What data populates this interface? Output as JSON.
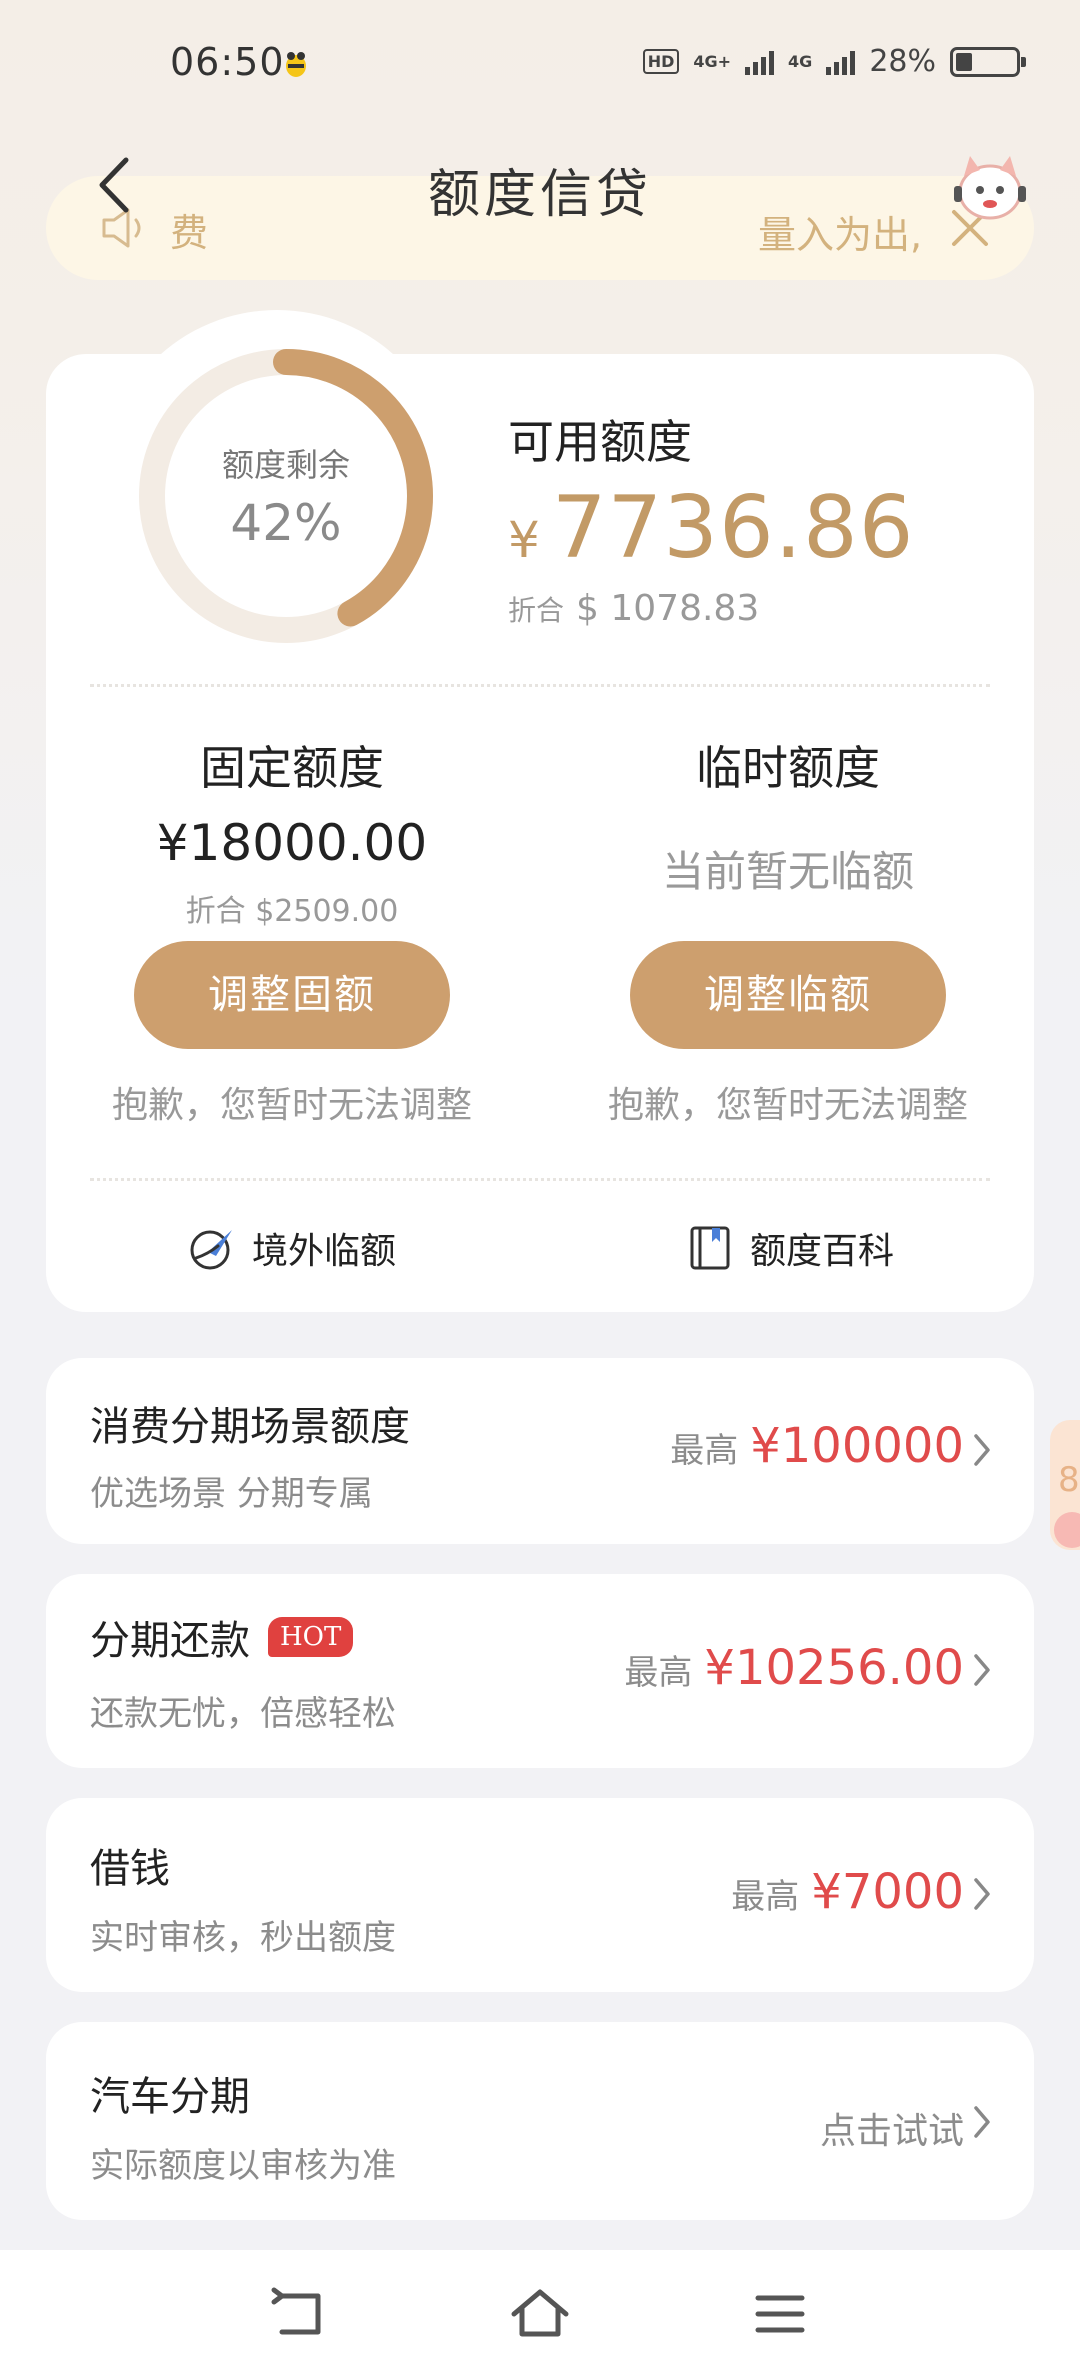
{
  "status_bar": {
    "time": "06:50",
    "hd": "HD",
    "net1": "4G+",
    "net2": "4G",
    "battery_text": "28%",
    "battery_level": 0.28
  },
  "header": {
    "title": "额度信贷"
  },
  "notice": {
    "text_left": "费",
    "text_right": "量入为出,"
  },
  "credit": {
    "ring_label": "额度剩余",
    "ring_value": "42%",
    "ring_fraction": 0.42,
    "available_title": "可用额度",
    "available_currency": "¥",
    "available_amount": "7736.86",
    "available_equiv_label": "折合",
    "available_equiv_value": "$ 1078.83"
  },
  "fixed_quota": {
    "title": "固定额度",
    "amount": "¥18000.00",
    "equiv": "折合 $2509.00",
    "button": "调整固额",
    "tip": "抱歉，您暂时无法调整"
  },
  "temp_quota": {
    "title": "临时额度",
    "status": "当前暂无临额",
    "button": "调整临额",
    "tip": "抱歉，您暂时无法调整"
  },
  "quick_links": {
    "overseas": "境外临额",
    "wiki": "额度百科"
  },
  "list_items": [
    {
      "title": "消费分期场景额度",
      "subtitle": "优选场景 分期专属",
      "max_label": "最高",
      "value": "¥100000"
    },
    {
      "title": "分期还款",
      "badge": "HOT",
      "subtitle": "还款无忧，倍感轻松",
      "max_label": "最高",
      "value": "¥10256.00"
    },
    {
      "title": "借钱",
      "subtitle": "实时审核，秒出额度",
      "max_label": "最高",
      "value": "¥7000"
    },
    {
      "title": "汽车分期",
      "subtitle": "实际额度以审核为准",
      "action": "点击试试"
    }
  ],
  "side_promo": {
    "text": "8"
  },
  "colors": {
    "accent": "#cd9f6e",
    "amount_gold": "#c29a66",
    "ring_track": "#f3ece4",
    "red": "#e04b4b"
  }
}
